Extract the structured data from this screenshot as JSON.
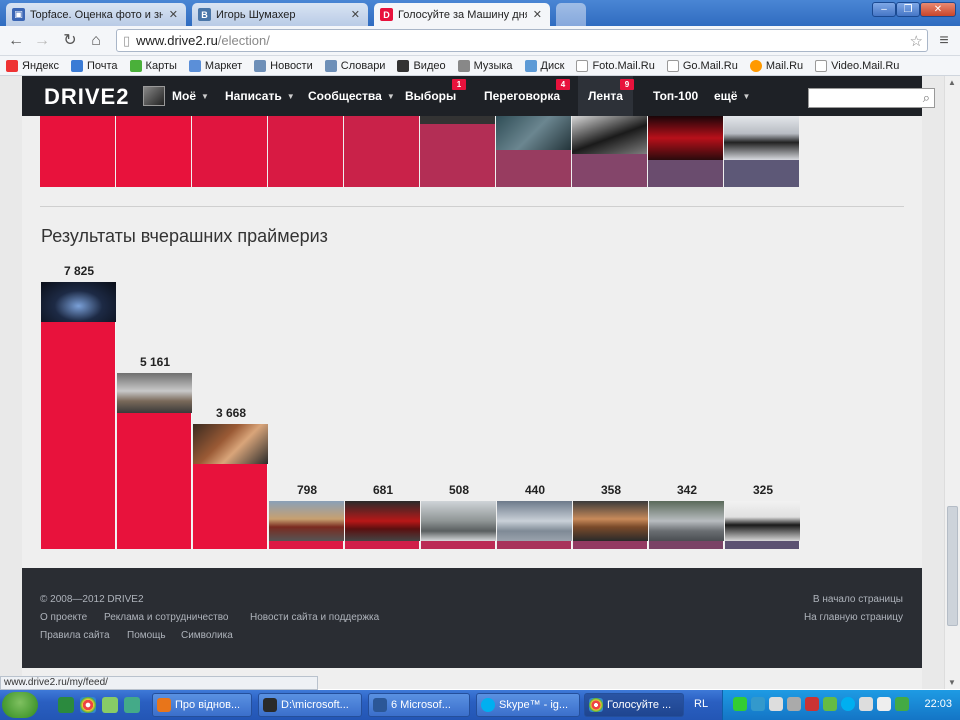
{
  "browser": {
    "tabs": [
      {
        "title": "Topface. Оценка фото и зн",
        "icon": "topface-favicon",
        "active": false
      },
      {
        "title": "Игорь Шумахер",
        "icon": "vk-favicon",
        "active": false
      },
      {
        "title": "Голосуйте за Машину дня",
        "icon": "drive2-favicon",
        "active": true
      }
    ],
    "url_host": "www.drive2.ru",
    "url_path": "/election/",
    "bookmarks": [
      "Яндекс",
      "Почта",
      "Карты",
      "Маркет",
      "Новости",
      "Словари",
      "Видео",
      "Музыка",
      "Диск",
      "Foto.Mail.Ru",
      "Go.Mail.Ru",
      "Mail.Ru",
      "Video.Mail.Ru"
    ],
    "status_url": "www.drive2.ru/my/feed/"
  },
  "site": {
    "logo": "DRIVE2",
    "nav": [
      {
        "label": "Моё",
        "dropdown": true
      },
      {
        "label": "Написать",
        "dropdown": true
      },
      {
        "label": "Сообщества",
        "dropdown": true
      },
      {
        "label": "Выборы",
        "badge": "1"
      },
      {
        "label": "Переговорка",
        "badge": "4"
      },
      {
        "label": "Лента",
        "badge": "9",
        "active": true
      },
      {
        "label": "Топ-100"
      },
      {
        "label": "ещё",
        "dropdown": true
      }
    ],
    "search_placeholder": ""
  },
  "results": {
    "title": "Результаты вчерашних праймериз"
  },
  "chart_data": {
    "type": "bar",
    "categories": [
      "",
      "",
      "",
      "",
      "",
      "",
      "",
      "",
      "",
      ""
    ],
    "values": [
      7825,
      5161,
      3668,
      798,
      681,
      508,
      440,
      358,
      342,
      325
    ],
    "labels": [
      "7 825",
      "5 161",
      "3 668",
      "798",
      "681",
      "508",
      "440",
      "358",
      "342",
      "325"
    ],
    "colors": [
      "#e8123c",
      "#e8123c",
      "#e8123c",
      "#dc1a45",
      "#d01f4a",
      "#bb2a55",
      "#a8325b",
      "#933a62",
      "#7a4366",
      "#5c5272"
    ],
    "title": "Результаты вчерашних праймериз",
    "xlabel": "",
    "ylabel": "",
    "ylim": [
      0,
      7825
    ],
    "grid": false
  },
  "footer": {
    "copyright": "© 2008—2012 DRIVE2",
    "links_row1": [
      "О проекте",
      "Реклама и сотрудничество",
      "Новости сайта и поддержка"
    ],
    "links_row2": [
      "Правила сайта",
      "Помощь",
      "Символика"
    ],
    "right_links": [
      "В начало страницы",
      "На главную страницу"
    ]
  },
  "taskbar": {
    "items": [
      {
        "label": "Про вiднов...",
        "icon": "firefox-icon"
      },
      {
        "label": "D:\\microsoft...",
        "icon": "folder-icon"
      },
      {
        "label": "6 Microsof...",
        "icon": "word-icon"
      },
      {
        "label": "Skype™ - ig...",
        "icon": "skype-icon"
      },
      {
        "label": "Голосуйте ...",
        "icon": "chrome-icon",
        "active": true
      }
    ],
    "lang": "RL",
    "clock": "22:03"
  }
}
